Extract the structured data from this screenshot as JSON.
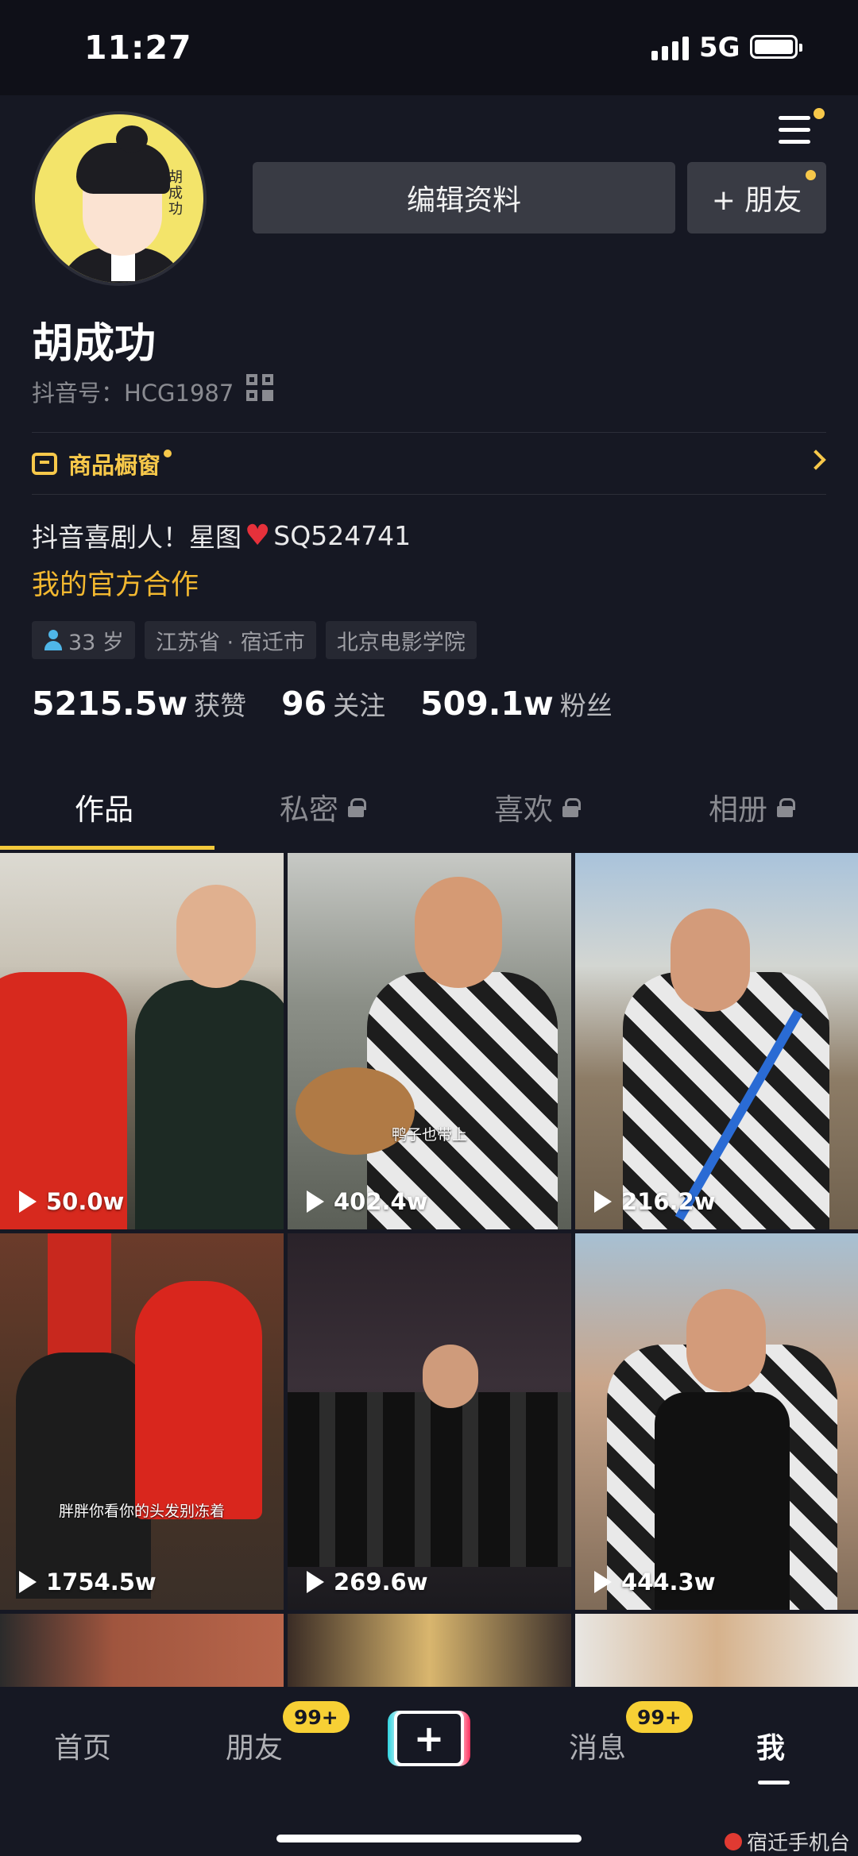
{
  "status_bar": {
    "time": "11:27",
    "network": "5G"
  },
  "profile": {
    "edit_button": "编辑资料",
    "friend_button": "+ 朋友",
    "nickname": "胡成功",
    "douyin_id": "抖音号：HCG1987",
    "shop_label": "商品橱窗",
    "bio_prefix": "抖音喜剧人！星图",
    "bio_heart": "❤️",
    "bio_suffix": "SQ524741",
    "official_link": "我的官方合作",
    "tags": [
      "33 岁",
      "江苏省 · 宿迁市",
      "北京电影学院"
    ],
    "stats": [
      {
        "value": "5215.5w",
        "label": "获赞"
      },
      {
        "value": "96",
        "label": "关注"
      },
      {
        "value": "509.1w",
        "label": "粉丝"
      }
    ]
  },
  "tabs": [
    "作品",
    "私密",
    "喜欢",
    "相册"
  ],
  "videos": [
    {
      "views": "50.0w",
      "caption": ""
    },
    {
      "views": "402.4w",
      "caption": "鸭子也带上"
    },
    {
      "views": "216.2w",
      "caption": ""
    },
    {
      "views": "1754.5w",
      "caption": "胖胖你看你的头发别冻着"
    },
    {
      "views": "269.6w",
      "caption": ""
    },
    {
      "views": "444.3w",
      "caption": ""
    }
  ],
  "bottom_nav": {
    "home": "首页",
    "friends": "朋友",
    "friends_badge": "99+",
    "plus": "+",
    "messages": "消息",
    "messages_badge": "99+",
    "me": "我"
  },
  "watermark": "宿迁手机台",
  "colors": {
    "accent": "#f3c93b",
    "background": "#161823",
    "heart": "#e6313b"
  }
}
